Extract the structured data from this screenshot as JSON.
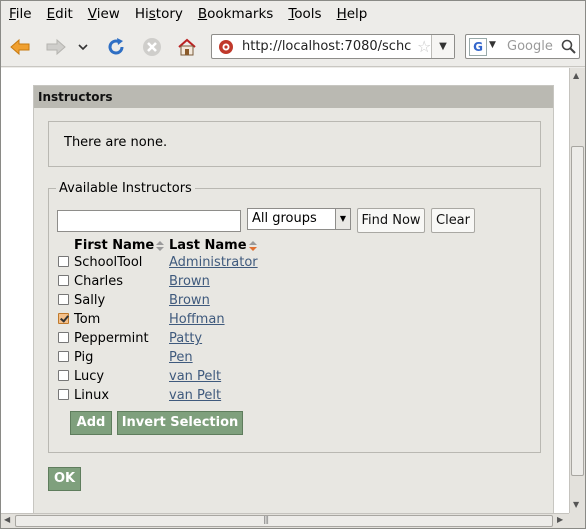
{
  "menu": [
    {
      "label": "File",
      "key": "F",
      "rest": "ile"
    },
    {
      "label": "Edit",
      "key": "E",
      "rest": "dit"
    },
    {
      "label": "View",
      "key": "V",
      "rest": "iew"
    },
    {
      "label": "History",
      "key": "s",
      "pre": "Hi",
      "rest": "tory"
    },
    {
      "label": "Bookmarks",
      "key": "B",
      "rest": "ookmarks"
    },
    {
      "label": "Tools",
      "key": "T",
      "rest": "ools"
    },
    {
      "label": "Help",
      "key": "H",
      "rest": "elp"
    }
  ],
  "toolbar": {
    "url": "http://localhost:7080/schc",
    "search_placeholder": "Google",
    "search_engine_letter": "G",
    "icons": [
      "back-icon",
      "forward-icon",
      "history-dropdown-icon",
      "reload-icon",
      "stop-icon",
      "home-icon"
    ]
  },
  "page": {
    "header": "Instructors",
    "empty_message": "There are none.",
    "available_legend": "Available Instructors",
    "group_select": "All groups",
    "find_button": "Find Now",
    "clear_button": "Clear",
    "col_first": "First Name",
    "col_last": "Last Name",
    "rows": [
      {
        "first": "SchoolTool",
        "last": "Administrator",
        "checked": false
      },
      {
        "first": "Charles",
        "last": "Brown",
        "checked": false
      },
      {
        "first": "Sally",
        "last": "Brown",
        "checked": false
      },
      {
        "first": "Tom",
        "last": "Hoffman",
        "checked": true
      },
      {
        "first": "Peppermint",
        "last": "Patty",
        "checked": false
      },
      {
        "first": "Pig",
        "last": "Pen",
        "checked": false
      },
      {
        "first": "Lucy",
        "last": "van Pelt",
        "checked": false
      },
      {
        "first": "Linux",
        "last": "van Pelt",
        "checked": false
      }
    ],
    "add_button": "Add",
    "invert_button": "Invert Selection",
    "ok_button": "OK"
  },
  "colors": {
    "header_bg": "#bab9b2",
    "green_button": "#7fa07d",
    "link": "#3f5a7d"
  }
}
